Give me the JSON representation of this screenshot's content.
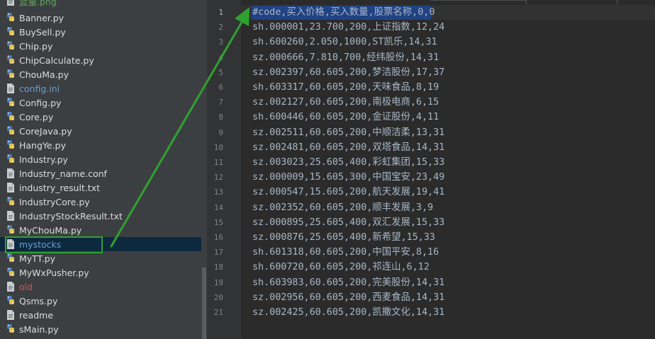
{
  "project_tree": {
    "partial_top_item": "蓝量.png",
    "items": [
      {
        "label": "Banner.py",
        "icon": "python-file-icon",
        "color": "white"
      },
      {
        "label": "BuySell.py",
        "icon": "python-file-icon",
        "color": "white"
      },
      {
        "label": "Chip.py",
        "icon": "python-file-icon",
        "color": "white"
      },
      {
        "label": "ChipCalculate.py",
        "icon": "python-file-icon",
        "color": "white"
      },
      {
        "label": "ChouMa.py",
        "icon": "python-file-icon",
        "color": "white"
      },
      {
        "label": "config.ini",
        "icon": "text-file-icon",
        "color": "blue"
      },
      {
        "label": "Config.py",
        "icon": "python-file-icon",
        "color": "white"
      },
      {
        "label": "Core.py",
        "icon": "python-file-icon",
        "color": "white"
      },
      {
        "label": "CoreJava.py",
        "icon": "python-file-icon",
        "color": "white"
      },
      {
        "label": "HangYe.py",
        "icon": "python-file-icon",
        "color": "white"
      },
      {
        "label": "Industry.py",
        "icon": "python-file-icon",
        "color": "white"
      },
      {
        "label": "Industry_name.conf",
        "icon": "text-file-icon",
        "color": "white"
      },
      {
        "label": "industry_result.txt",
        "icon": "text-file-icon",
        "color": "white"
      },
      {
        "label": "IndustryCore.py",
        "icon": "python-file-icon",
        "color": "white"
      },
      {
        "label": "IndustryStockResult.txt",
        "icon": "text-file-icon",
        "color": "white"
      },
      {
        "label": "MyChouMa.py",
        "icon": "python-file-icon",
        "color": "white"
      },
      {
        "label": "mystocks",
        "icon": "text-file-icon",
        "color": "blue",
        "selected": true
      },
      {
        "label": "MyTT.py",
        "icon": "python-file-icon",
        "color": "white"
      },
      {
        "label": "MyWxPusher.py",
        "icon": "python-file-icon",
        "color": "white"
      },
      {
        "label": "old",
        "icon": "text-file-icon",
        "color": "red"
      },
      {
        "label": "Qsms.py",
        "icon": "python-file-icon",
        "color": "white"
      },
      {
        "label": "readme",
        "icon": "text-file-icon",
        "color": "white"
      },
      {
        "label": "sMain.py",
        "icon": "python-file-icon",
        "color": "white"
      }
    ]
  },
  "editor": {
    "current_line": 1,
    "lines": [
      "#code,买入价格,买入数量,股票名称,0,0",
      "sh.000001,23.700,200,上证指数,12,24",
      "sh.600260,2.050,1000,ST凯乐,14,31",
      "sz.000666,7.810,700,经纬股份,14,31",
      "sz.002397,60.605,200,梦洁股份,17,37",
      "sh.603317,60.605,200,天味食品,8,19",
      "sz.002127,60.605,200,南极电商,6,15",
      "sh.600446,60.605,200,金证股份,4,11",
      "sz.002511,60.605,200,中顺洁柔,13,31",
      "sz.002481,60.605,200,双塔食品,14,31",
      "sz.003023,25.605,400,彩虹集团,15,33",
      "sz.000009,15.605,300,中国宝安,23,49",
      "sz.000547,15.605,200,航天发展,19,41",
      "sz.002352,60.605,200,顺丰发展,3,9",
      "sz.000895,25.605,400,双汇发展,15,33",
      "sz.000876,25.605,400,新希望,15,33",
      "sh.601318,60.605,200,中国平安,8,16",
      "sh.600720,60.605,200,祁连山,6,12",
      "sh.603983,60.605,200,完美股份,14,31",
      "sz.002956,60.605,200,西麦食品,14,31",
      "sz.002425,60.605,200,凯撒文化,14,31"
    ]
  },
  "colors": {
    "annotation_green": "#2fa12f",
    "selection": "#214283",
    "selected_row": "#0d293e"
  }
}
